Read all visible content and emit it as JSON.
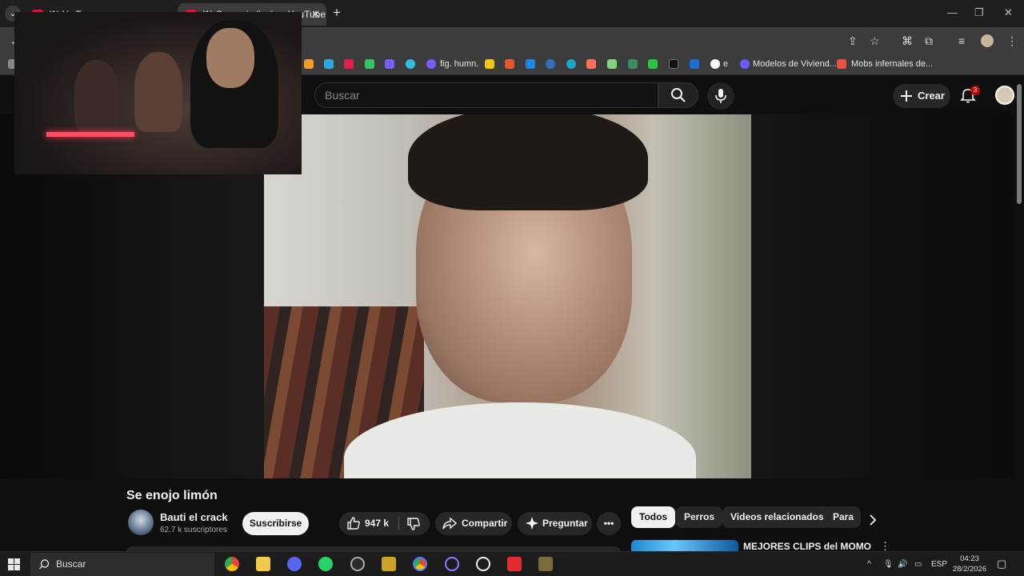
{
  "browser": {
    "tabs": [
      {
        "label": "(1) Y...T..."
      },
      {
        "label": "(1) Se enojo limón - YouTube"
      }
    ],
    "tab_close": "✕",
    "new_tab": "+",
    "window_controls": [
      "—",
      "❐",
      "✕"
    ],
    "bookmarks": [
      {
        "label": "fig. humn."
      },
      {
        "label": "e"
      },
      {
        "label": "Modelos de Viviend..."
      },
      {
        "label": "Mobs infernales de..."
      }
    ]
  },
  "youtube": {
    "search_placeholder": "Buscar",
    "create_label": "Crear",
    "notification_count": "3",
    "video_title": "Se enojo limón",
    "channel_name": "Bauti el crack",
    "subscriber_count": "62.7 k suscriptores",
    "subscribe_label": "Suscribirse",
    "like_count": "947 k",
    "share_label": "Compartir",
    "ask_label": "Preguntar",
    "more_label": "•••",
    "chips": [
      "Todos",
      "Perros",
      "Videos relacionados",
      "Para"
    ],
    "recommendation_title": "MEJORES CLIPS del MOMO",
    "recommendation_menu": "⋮"
  },
  "taskbar": {
    "search_label": "Buscar",
    "language": "ESP",
    "time": "04:23",
    "date": "28/2/2026"
  },
  "colors": {
    "accent_red": "#ff0033",
    "background": "#0f0f0f",
    "pill": "#272727"
  }
}
